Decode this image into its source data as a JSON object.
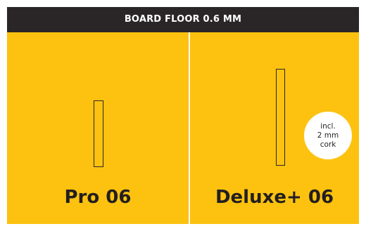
{
  "header": {
    "title": "BOARD FLOOR 0.6 MM"
  },
  "products": [
    {
      "name": "Pro 06"
    },
    {
      "name": "Deluxe+ 06",
      "badge": {
        "line1": "incl.",
        "line2": "2 mm",
        "line3": "cork"
      }
    }
  ],
  "colors": {
    "background": "#fcc20f",
    "header_bg": "#2a2627",
    "header_text": "#ffffff",
    "text": "#231f20",
    "divider": "#ffffff",
    "badge_bg": "#ffffff"
  }
}
